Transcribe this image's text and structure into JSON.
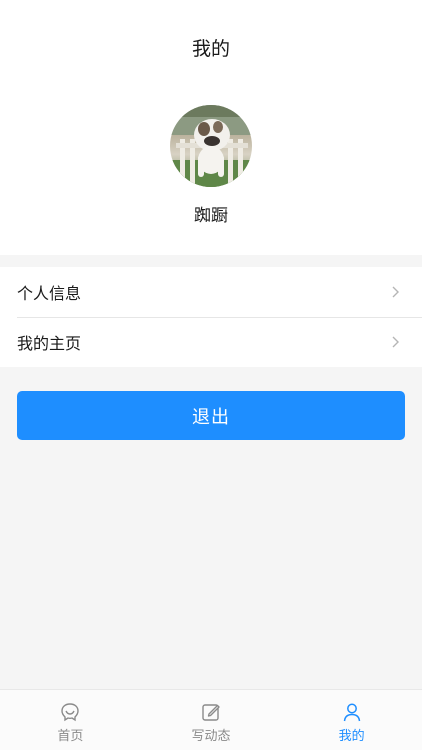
{
  "header": {
    "title": "我的"
  },
  "profile": {
    "username": "踟蹰"
  },
  "menu": {
    "items": [
      {
        "label": "个人信息"
      },
      {
        "label": "我的主页"
      }
    ]
  },
  "logout_label": "退出",
  "tabbar": {
    "tabs": [
      {
        "label": "首页",
        "icon": "home-icon"
      },
      {
        "label": "写动态",
        "icon": "edit-icon"
      },
      {
        "label": "我的",
        "icon": "user-icon",
        "active": true
      }
    ]
  },
  "colors": {
    "accent": "#1e8eff"
  }
}
